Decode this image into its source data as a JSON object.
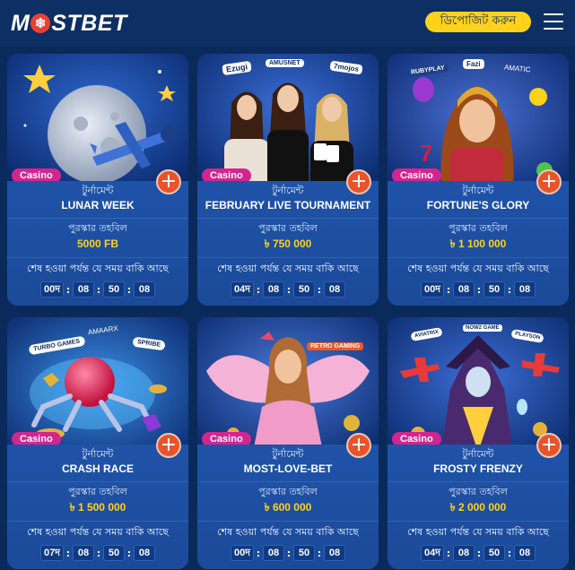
{
  "brand": {
    "logo_left": "M",
    "logo_right": "STBET"
  },
  "header": {
    "deposit_label": "ডিপোজিট করুন"
  },
  "labels": {
    "type": "টুর্নামেন্ট",
    "prize": "পুরস্কার তহবিল",
    "timer": "শেষ হওয়া পর্যন্ত যে সময় বাকি আছে",
    "badge": "Casino",
    "plus": "+"
  },
  "cards": [
    {
      "name": "LUNAR WEEK",
      "prize": "5000 FB",
      "timer": [
        "00দ",
        "08",
        "50",
        "08"
      ]
    },
    {
      "name": "FEBRUARY LIVE TOURNAMENT",
      "prize": "৳ 750 000",
      "timer": [
        "04দ",
        "08",
        "50",
        "08"
      ],
      "logos": [
        "Ezugi",
        "AMUSNET",
        "7mojos"
      ]
    },
    {
      "name": "FORTUNE'S GLORY",
      "prize": "৳ 1 100 000",
      "timer": [
        "00দ",
        "08",
        "50",
        "08"
      ],
      "logos": [
        "RUBYPLAY",
        "Fazi",
        "AMATIC"
      ]
    },
    {
      "name": "CRASH RACE",
      "prize": "৳ 1 500 000",
      "timer": [
        "07দ",
        "08",
        "50",
        "08"
      ],
      "logos": [
        "TURBO GAMES",
        "AMAARX",
        "SPRIBE"
      ]
    },
    {
      "name": "MOST-LOVE-BET",
      "prize": "৳ 600 000",
      "timer": [
        "00দ",
        "08",
        "50",
        "08"
      ],
      "logos": [
        "RETRO GAMING"
      ]
    },
    {
      "name": "FROSTY FRENZY",
      "prize": "৳ 2 000 000",
      "timer": [
        "04দ",
        "08",
        "50",
        "08"
      ],
      "logos": [
        "AVIATRIX",
        "NOW2 GAME",
        "PLAYSON"
      ]
    }
  ],
  "colors": {
    "background": "#0b2a5c",
    "card": "#1a4b9b",
    "accent": "#ffd21a",
    "badge": "#d2268f",
    "plus": "#e8542a"
  },
  "icons": {
    "menu": "hamburger-menu-icon",
    "plus": "plus-circle-icon",
    "logo_mark": "snowflake-icon"
  }
}
